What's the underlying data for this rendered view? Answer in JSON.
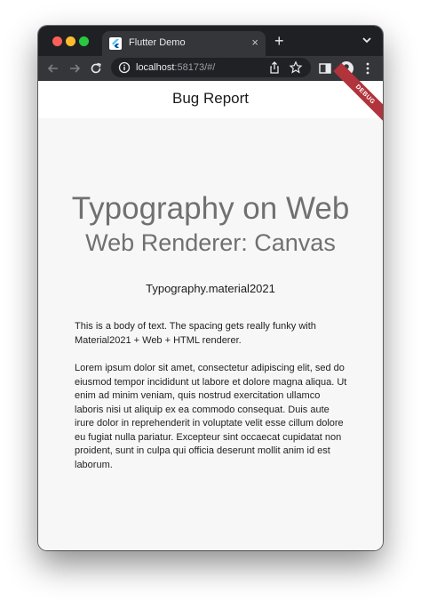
{
  "browser": {
    "tab": {
      "title": "Flutter Demo",
      "close": "×"
    },
    "new_tab": "+",
    "url": {
      "host": "localhost",
      "rest": ":58173/#/"
    },
    "icons": [
      "flutter-logo-icon",
      "tab-close-icon",
      "new-tab-icon",
      "tab-menu-icon",
      "back-icon",
      "forward-icon",
      "reload-icon",
      "site-info-icon",
      "share-icon",
      "bookmark-star-icon",
      "side-panel-icon",
      "profile-icon",
      "more-menu-icon"
    ]
  },
  "app": {
    "title": "Bug Report",
    "debug_banner": "DEBUG",
    "headline": "Typography on Web",
    "subhead": "Web Renderer: Canvas",
    "style_name": "Typography.material2021",
    "paragraph1": "This is a body of text.  The spacing gets really funky with Material2021 + Web + HTML renderer.",
    "paragraph2": "Lorem ipsum dolor sit amet, consectetur adipiscing elit, sed do eiusmod tempor incididunt ut labore et dolore magna aliqua. Ut enim ad minim veniam, quis nostrud exercitation ullamco laboris nisi ut aliquip ex ea commodo consequat. Duis aute irure dolor in reprehenderit in voluptate velit esse cillum dolore eu fugiat nulla pariatur. Excepteur sint occaecat cupidatat non proident, sunt in culpa qui officia deserunt mollit anim id est laborum."
  },
  "colors": {
    "debug_banner": "#b1333b",
    "headline": "#707070",
    "tabstrip": "#1f2023",
    "toolbar": "#35363a"
  }
}
